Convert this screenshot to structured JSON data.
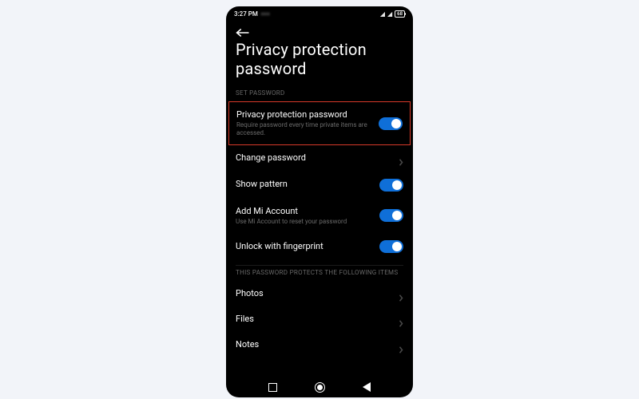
{
  "status": {
    "time": "3:27 PM",
    "battery_text": "68"
  },
  "page": {
    "title": "Privacy protection password"
  },
  "sections": {
    "set_password_label": "SET PASSWORD",
    "protects_label": "THIS PASSWORD PROTECTS THE FOLLOWING ITEMS"
  },
  "rows": {
    "ppp": {
      "title": "Privacy protection password",
      "sub": "Require password every time private items are accessed.",
      "toggle": true
    },
    "change": {
      "title": "Change password"
    },
    "pattern": {
      "title": "Show pattern",
      "toggle": true
    },
    "mi": {
      "title": "Add Mi Account",
      "sub": "Use Mi Account to reset your password",
      "toggle": true
    },
    "fingerprint": {
      "title": "Unlock with fingerprint",
      "toggle": true
    },
    "photos": {
      "title": "Photos"
    },
    "files": {
      "title": "Files"
    },
    "notes": {
      "title": "Notes"
    }
  },
  "colors": {
    "accent": "#0f6fd8",
    "highlight_border": "#d83a2a",
    "bg": "#000000"
  }
}
